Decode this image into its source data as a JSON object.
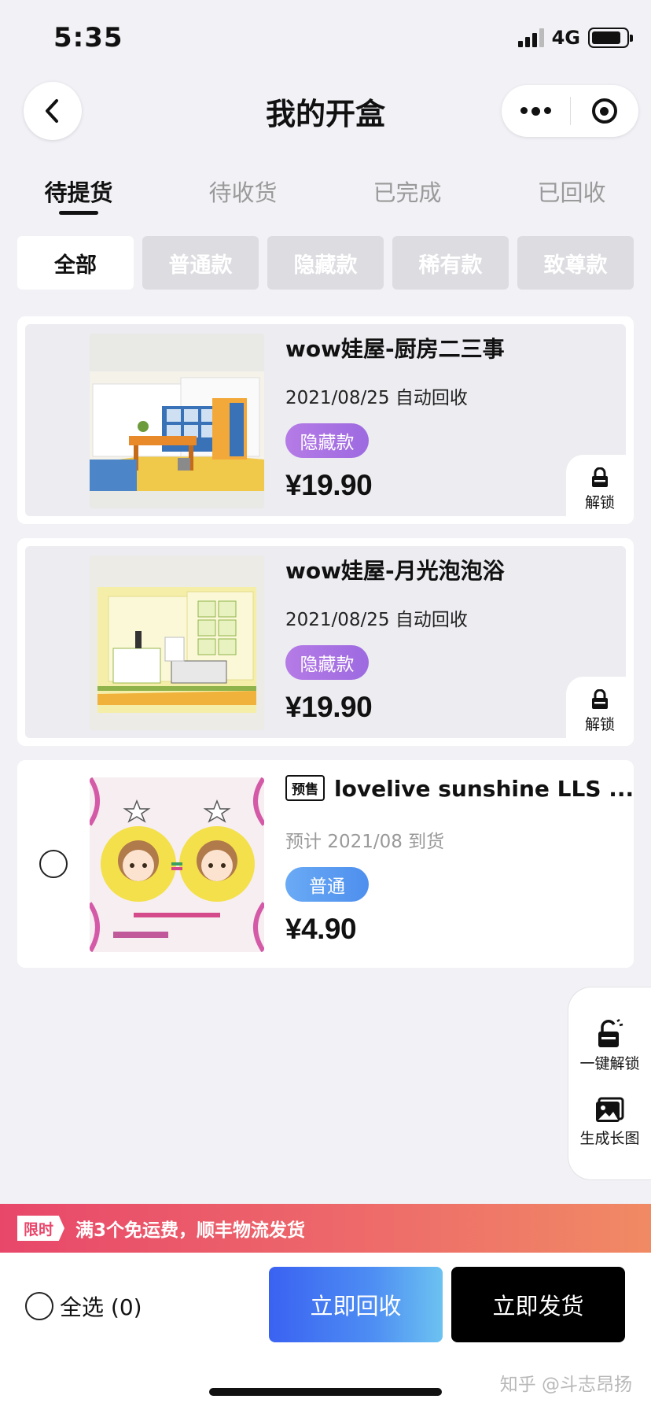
{
  "status_bar": {
    "time": "5:35",
    "network": "4G",
    "battery_level": 0.85
  },
  "nav": {
    "title": "我的开盒"
  },
  "tabs": [
    {
      "label": "待提货",
      "active": true
    },
    {
      "label": "待收货",
      "active": false
    },
    {
      "label": "已完成",
      "active": false
    },
    {
      "label": "已回收",
      "active": false
    }
  ],
  "filters": [
    {
      "label": "全部",
      "active": true
    },
    {
      "label": "普通款",
      "active": false
    },
    {
      "label": "隐藏款",
      "active": false
    },
    {
      "label": "稀有款",
      "active": false
    },
    {
      "label": "致尊款",
      "active": false
    }
  ],
  "items": [
    {
      "title": "wow娃屋-厨房二三事",
      "date": "2021/08/25 自动回收",
      "badge": "隐藏款",
      "price": "¥19.90",
      "unlock_label": "解锁"
    },
    {
      "title": "wow娃屋-月光泡泡浴",
      "date": "2021/08/25 自动回收",
      "badge": "隐藏款",
      "price": "¥19.90",
      "unlock_label": "解锁"
    },
    {
      "presale_tag": "预售",
      "title": "lovelive sunshine LLS ...",
      "date": "预计 2021/08 到货",
      "badge": "普通",
      "price": "¥4.90"
    }
  ],
  "side_panel": {
    "unlock_all": "一键解锁",
    "long_image": "生成长图"
  },
  "promo": {
    "tag": "限时",
    "text": "满3个免运费，顺丰物流发货"
  },
  "bottom": {
    "select_all": "全选 (0)",
    "recycle": "立即回收",
    "ship": "立即发货"
  },
  "watermark": "知乎 @斗志昂扬",
  "colors": {
    "hidden_badge": "#a773e4",
    "normal_badge": "#5c9cf2",
    "promo_start": "#e8476a",
    "promo_end": "#f08a64",
    "recycle_start": "#3a62f2",
    "recycle_end": "#6cc2f1"
  }
}
